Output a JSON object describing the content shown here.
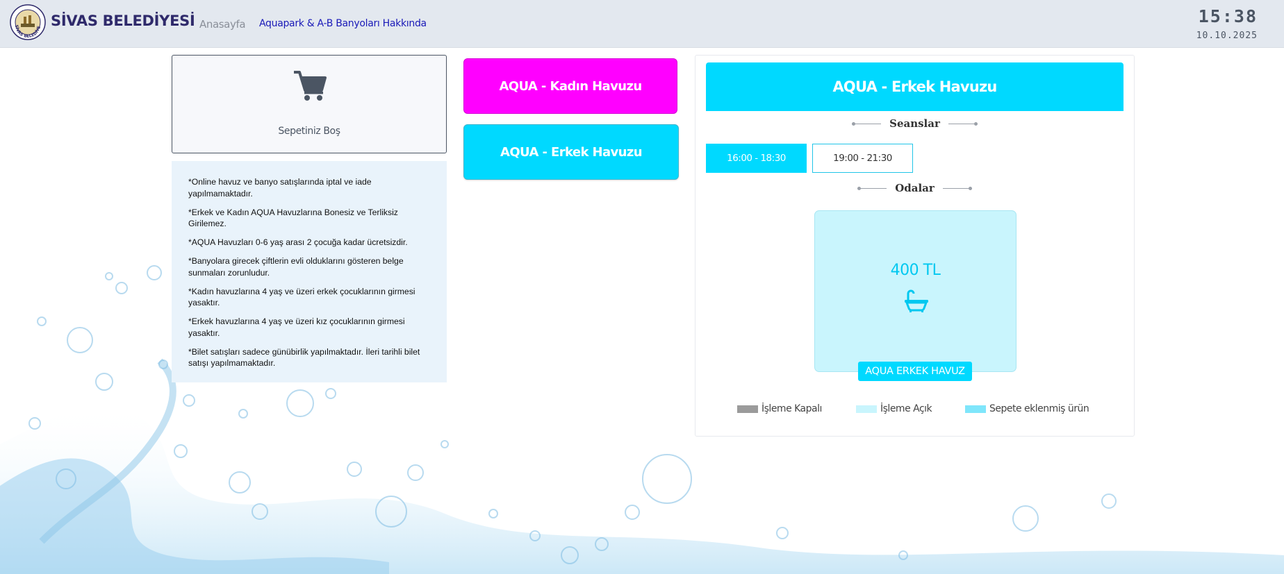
{
  "header": {
    "brand": "SİVAS BELEDİYESİ",
    "logo_text": "SİVAS BELEDİYESİ",
    "nav_home": "Anasayfa",
    "nav_about": "Aquapark & A-B Banyoları Hakkında",
    "clock_time": "15:38",
    "clock_date": "10.10.2025"
  },
  "cart": {
    "icon": "shopping-cart-icon",
    "label": "Sepetiniz Boş"
  },
  "rules": [
    "*Online havuz ve banyo satışlarında iptal ve iade yapılmamaktadır.",
    "*Erkek ve Kadın AQUA Havuzlarına Bonesiz ve Terliksiz Girilemez.",
    "*AQUA Havuzları 0-6 yaş arası 2 çocuğa kadar ücretsizdir.",
    "*Banyolara girecek çiftlerin evli olduklarını gösteren belge sunmaları zorunludur.",
    "*Kadın havuzlarına 4 yaş ve üzeri erkek çocuklarının girmesi yasaktır.",
    "*Erkek havuzlarına 4 yaş ve üzeri kız çocuklarının girmesi yasaktır.",
    "*Bilet satışları sadece günübirlik yapılmaktadır. İleri tarihli bilet satışı yapılmamaktadır."
  ],
  "pools": {
    "women_label": "AQUA - Kadın Havuzu",
    "men_label": "AQUA - Erkek Havuzu"
  },
  "panel": {
    "title": "AQUA - Erkek Havuzu",
    "sessions_title": "Seanslar",
    "sessions": [
      "16:00 - 18:30",
      "19:00 - 21:30"
    ],
    "selected_session": "16:00 - 18:30",
    "rooms_title": "Odalar",
    "room": {
      "price": "400 TL",
      "icon": "bathtub-icon",
      "name": "AQUA ERKEK HAVUZ"
    },
    "legend": [
      {
        "label": "İşleme Kapalı",
        "color": "#9b9b9b"
      },
      {
        "label": "İşleme Açık",
        "color": "#c9f5fd"
      },
      {
        "label": "Sepete eklenmiş ürün",
        "color": "#7fe6fb"
      }
    ]
  },
  "colors": {
    "accent_cyan": "#00d9ff",
    "accent_magenta": "#ff00ff",
    "brand_navy": "#2f2a6b",
    "topbar_bg": "#e3e8ef"
  }
}
